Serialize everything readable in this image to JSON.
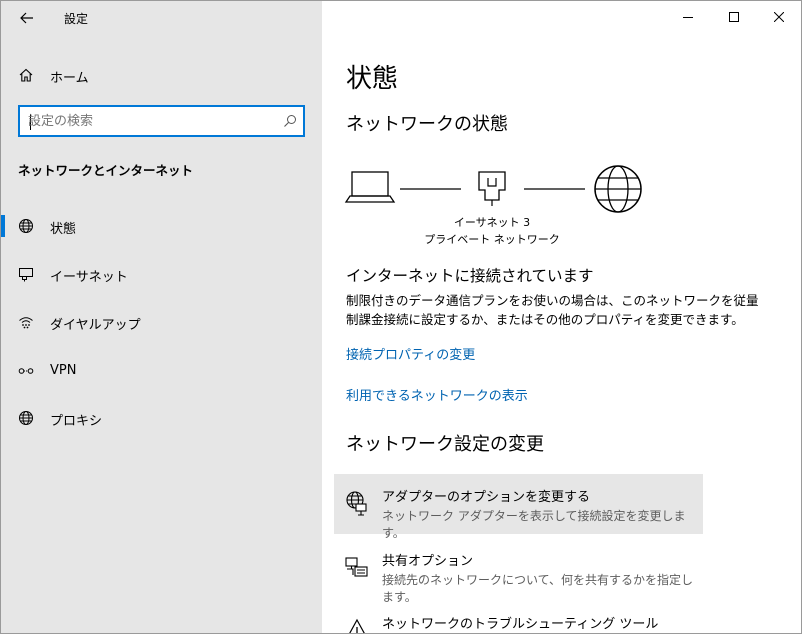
{
  "window": {
    "title": "設定",
    "controls": {
      "minimize": "minimize",
      "maximize": "maximize",
      "close": "close"
    }
  },
  "sidebar": {
    "home_label": "ホーム",
    "search_placeholder": "設定の検索",
    "section_title": "ネットワークとインターネット",
    "items": [
      {
        "label": "状態",
        "icon": "globe-icon",
        "active": true
      },
      {
        "label": "イーサネット",
        "icon": "ethernet-icon",
        "active": false
      },
      {
        "label": "ダイヤルアップ",
        "icon": "dialup-icon",
        "active": false
      },
      {
        "label": "VPN",
        "icon": "vpn-icon",
        "active": false
      },
      {
        "label": "プロキシ",
        "icon": "globe-icon",
        "active": false
      }
    ]
  },
  "main": {
    "title": "状態",
    "network_status_heading": "ネットワークの状態",
    "network": {
      "adapter_name": "イーサネット 3",
      "network_profile": "プライベート ネットワーク"
    },
    "connection_status": "インターネットに接続されています",
    "description": "制限付きのデータ通信プランをお使いの場合は、このネットワークを従量制課金接続に設定するか、またはその他のプロパティを変更できます。",
    "links": {
      "change_properties": "接続プロパティの変更",
      "show_networks": "利用できるネットワークの表示"
    },
    "change_settings_heading": "ネットワーク設定の変更",
    "options": [
      {
        "title": "アダプターのオプションを変更する",
        "subtitle": "ネットワーク アダプターを表示して接続設定を変更します。",
        "icon": "adapter-icon"
      },
      {
        "title": "共有オプション",
        "subtitle": "接続先のネットワークについて、何を共有するかを指定します。",
        "icon": "sharing-icon"
      },
      {
        "title": "ネットワークのトラブルシューティング ツール",
        "subtitle": "",
        "icon": "warning-icon"
      }
    ]
  },
  "colors": {
    "accent": "#0078d7",
    "link": "#0063b1",
    "sidebar_bg": "#e6e6e6"
  }
}
